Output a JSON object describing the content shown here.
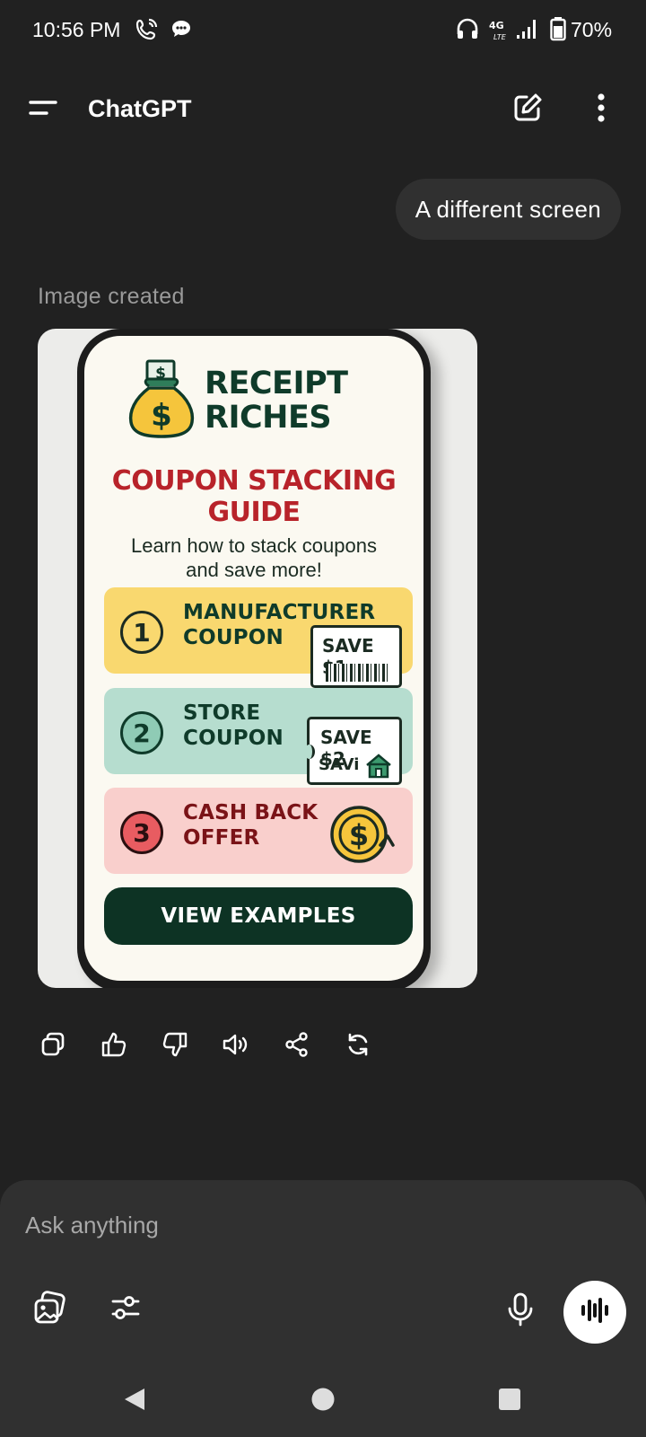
{
  "status_bar": {
    "time": "10:56 PM",
    "network": "4G LTE",
    "battery": "70%"
  },
  "app_bar": {
    "title": "ChatGPT"
  },
  "conversation": {
    "user_message": "A different screen",
    "assistant_label": "Image created",
    "image": {
      "brand_line1": "RECEIPT",
      "brand_line2": "RICHES",
      "headline_line1": "COUPON STACKING",
      "headline_line2": "GUIDE",
      "subtitle_line1": "Learn how to stack coupons",
      "subtitle_line2": "and save more!",
      "steps": [
        {
          "number": "1",
          "line1": "MANUFACTURER",
          "line2": "COUPON",
          "tag": "SAVE $1"
        },
        {
          "number": "2",
          "line1": "STORE",
          "line2": "COUPON",
          "tag": "SAVE $2",
          "tag_sub": "SAVi"
        },
        {
          "number": "3",
          "line1": "CASH BACK",
          "line2": "OFFER"
        }
      ],
      "button": "VIEW EXAMPLES",
      "colors": {
        "brand_green": "#0f3b2a",
        "headline_red": "#b8232a",
        "step1_bg": "#f9d86f",
        "step2_bg": "#b6ddcf",
        "step3_bg": "#f9cfcc"
      }
    },
    "actions": [
      "copy-icon",
      "thumbs-up-icon",
      "thumbs-down-icon",
      "read-aloud-icon",
      "share-icon",
      "regenerate-icon"
    ]
  },
  "composer": {
    "placeholder": "Ask anything"
  }
}
